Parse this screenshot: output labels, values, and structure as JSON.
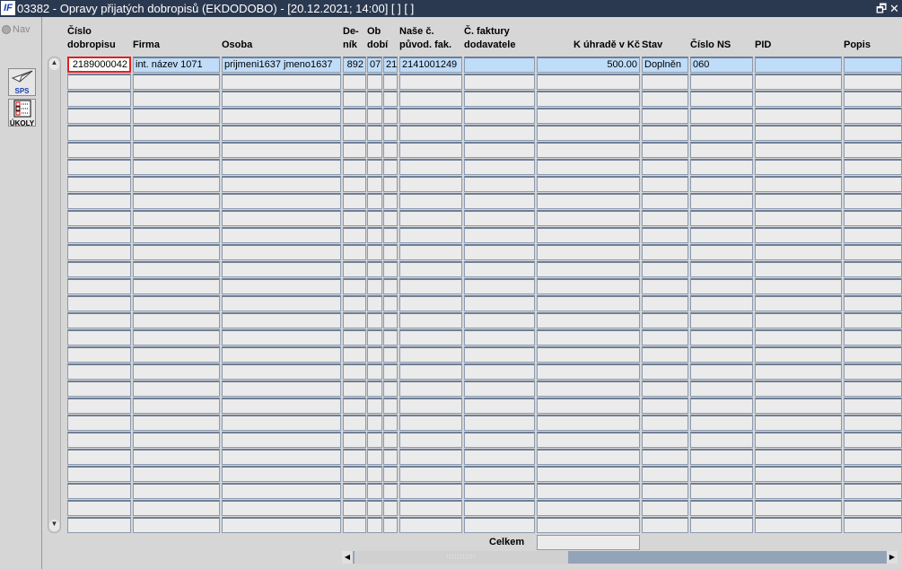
{
  "window": {
    "logo": "IF",
    "title": "03382 - Opravy přijatých dobropisů (EKDODOBO) - [20.12.2021; 14:00]  [ ]  [ ]",
    "restore": "🗗",
    "close": "✕"
  },
  "left": {
    "nav": "Nav",
    "sps": "SPS",
    "ukoly": "ÚKOLY"
  },
  "columns": [
    {
      "id": "cislo",
      "l1": "Číslo",
      "l2": "dobropisu"
    },
    {
      "id": "firma",
      "l1": "",
      "l2": "Firma"
    },
    {
      "id": "osoba",
      "l1": "",
      "l2": "Osoba"
    },
    {
      "id": "denik",
      "l1": "De-",
      "l2": "ník"
    },
    {
      "id": "obdobi",
      "l1": "Ob",
      "l2": "dobí"
    },
    {
      "id": "rok",
      "l1": "",
      "l2": ""
    },
    {
      "id": "nase",
      "l1": "Naše č.",
      "l2": "původ. fak."
    },
    {
      "id": "cfak",
      "l1": "Č. faktury",
      "l2": "dodavatele"
    },
    {
      "id": "kuhrade",
      "l1": "",
      "l2": "K úhradě v Kč"
    },
    {
      "id": "stav",
      "l1": "",
      "l2": "Stav"
    },
    {
      "id": "ns",
      "l1": "",
      "l2": "Číslo NS"
    },
    {
      "id": "pid",
      "l1": "",
      "l2": "PID"
    },
    {
      "id": "popis",
      "l1": "",
      "l2": "Popis"
    }
  ],
  "rows": [
    [
      "2189000042",
      "int. název 1071",
      "prijmeni1637 jmeno1637",
      "892",
      "07",
      "21",
      "2141001249",
      "",
      "500.00",
      "Doplněn",
      "060",
      "",
      ""
    ]
  ],
  "footer": {
    "celkem_label": "Celkem",
    "celkem_value": ""
  }
}
